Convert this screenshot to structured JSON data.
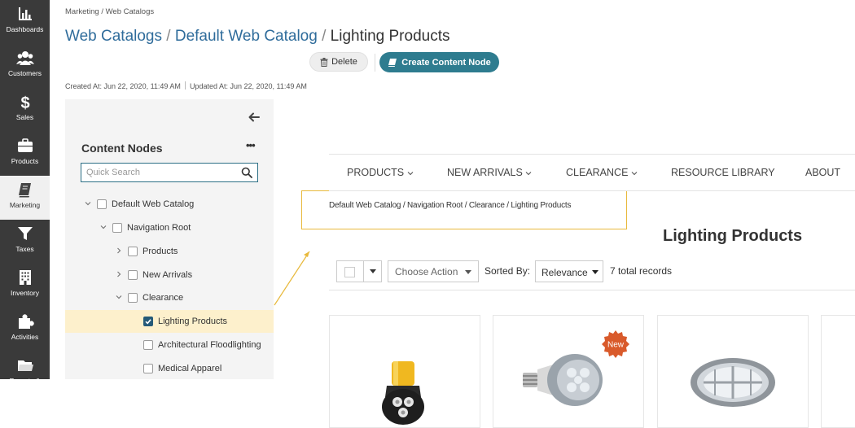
{
  "nav": {
    "items": [
      {
        "label": "Dashboards",
        "icon": "bar-chart-icon"
      },
      {
        "label": "Customers",
        "icon": "users-icon"
      },
      {
        "label": "Sales",
        "icon": "dollar-icon"
      },
      {
        "label": "Products",
        "icon": "briefcase-icon"
      },
      {
        "label": "Marketing",
        "icon": "book-icon",
        "active": true
      },
      {
        "label": "Taxes",
        "icon": "filter-icon"
      },
      {
        "label": "Inventory",
        "icon": "building-icon"
      },
      {
        "label": "Activities",
        "icon": "puzzle-icon"
      },
      {
        "label": "Reports &",
        "icon": "folder-icon"
      }
    ]
  },
  "header": {
    "breadcrumb": "Marketing / Web Catalogs",
    "title_parts": [
      "Web Catalogs",
      "/",
      "Default Web Catalog",
      "/",
      "Lighting Products"
    ],
    "delete_label": "Delete",
    "create_label": "Create Content Node",
    "created_at": "Created At: Jun 22, 2020, 11:49 AM",
    "updated_at": "Updated At: Jun 22, 2020, 11:49 AM"
  },
  "tree": {
    "title": "Content Nodes",
    "more": "•••",
    "search_placeholder": "Quick Search",
    "nodes": [
      {
        "label": "Default Web Catalog",
        "level": 0,
        "expand": "open",
        "checked": false
      },
      {
        "label": "Navigation Root",
        "level": 1,
        "expand": "open",
        "checked": false
      },
      {
        "label": "Products",
        "level": 2,
        "expand": "closed",
        "checked": false
      },
      {
        "label": "New Arrivals",
        "level": 2,
        "expand": "closed",
        "checked": false
      },
      {
        "label": "Clearance",
        "level": 2,
        "expand": "open",
        "checked": false
      },
      {
        "label": "Lighting Products",
        "level": 3,
        "expand": "none",
        "checked": true,
        "selected": true
      },
      {
        "label": "Architectural Floodlighting",
        "level": 3,
        "expand": "none",
        "checked": false
      },
      {
        "label": "Medical Apparel",
        "level": 3,
        "expand": "none",
        "checked": false
      }
    ]
  },
  "preview": {
    "nav": [
      "PRODUCTS",
      "NEW ARRIVALS",
      "CLEARANCE",
      "RESOURCE LIBRARY",
      "ABOUT"
    ],
    "breadcrumb": "Default Web Catalog / Navigation Root / Clearance / Lighting Products",
    "heading": "Lighting Products",
    "choose_action": "Choose Action",
    "sorted_by": "Sorted By:",
    "sort_value": "Relevance",
    "total_records": "7 total records",
    "badge": "New"
  },
  "colors": {
    "nav_bg": "#3a3a3a",
    "link": "#2f6c9b",
    "primary_button": "#2e7c8f",
    "selected_row": "#fdf0cc",
    "callout": "#e8b93c",
    "badge": "#d95a2b"
  }
}
